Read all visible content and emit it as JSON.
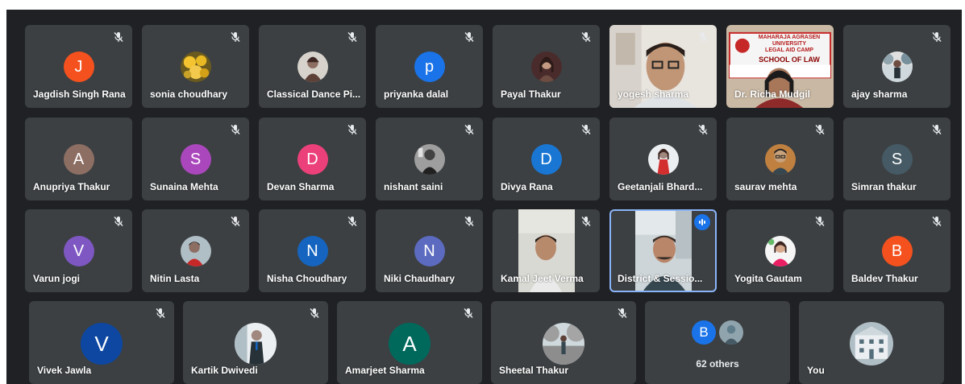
{
  "meeting": {
    "participants": [
      {
        "name": "Jagdish Singh Rana",
        "avatar": {
          "kind": "letter",
          "letter": "J",
          "color": "#f4511e"
        },
        "muted": true
      },
      {
        "name": "sonia choudhary",
        "avatar": {
          "kind": "photo",
          "photo": "yellow-flowers"
        },
        "muted": true
      },
      {
        "name": "Classical Dance Pi...",
        "avatar": {
          "kind": "photo",
          "photo": "dancer"
        },
        "muted": true
      },
      {
        "name": "priyanka dalal",
        "avatar": {
          "kind": "letter",
          "letter": "p",
          "color": "#1a73e8"
        },
        "muted": true
      },
      {
        "name": "Payal Thakur",
        "avatar": {
          "kind": "photo",
          "photo": "woman"
        },
        "muted": true
      },
      {
        "name": "yogesh sharma",
        "video": "man-with-glasses",
        "muted": true
      },
      {
        "name": "Dr. Richa Mudgil",
        "video": "woman-at-banner",
        "banner": [
          "MAHARAJA AGRASEN",
          "UNIVERSITY",
          "LEGAL AID CAMP",
          "SCHOOL OF LAW"
        ]
      },
      {
        "name": "ajay sharma",
        "avatar": {
          "kind": "photo",
          "photo": "person-trees"
        },
        "muted": true
      },
      {
        "name": "Anupriya Thakur",
        "avatar": {
          "kind": "letter",
          "letter": "A",
          "color": "#8d6e63"
        },
        "muted": false
      },
      {
        "name": "Sunaina Mehta",
        "avatar": {
          "kind": "letter",
          "letter": "S",
          "color": "#ab47bc"
        },
        "muted": true
      },
      {
        "name": "Devan Sharma",
        "avatar": {
          "kind": "letter",
          "letter": "D",
          "color": "#ec407a"
        },
        "muted": true
      },
      {
        "name": "nishant saini",
        "avatar": {
          "kind": "photo",
          "photo": "man-bw"
        },
        "muted": true
      },
      {
        "name": "Divya Rana",
        "avatar": {
          "kind": "letter",
          "letter": "D",
          "color": "#1976d2"
        },
        "muted": true
      },
      {
        "name": "Geetanjali Bhard...",
        "avatar": {
          "kind": "photo",
          "photo": "woman-red"
        },
        "muted": true
      },
      {
        "name": "saurav mehta",
        "avatar": {
          "kind": "photo",
          "photo": "man-glasses"
        },
        "muted": true
      },
      {
        "name": "Simran thakur",
        "avatar": {
          "kind": "letter",
          "letter": "S",
          "color": "#455a64"
        },
        "muted": true
      },
      {
        "name": "Varun jogi",
        "avatar": {
          "kind": "letter",
          "letter": "V",
          "color": "#7e57c2"
        },
        "muted": true
      },
      {
        "name": "Nitin Lasta",
        "avatar": {
          "kind": "photo",
          "photo": "man-red"
        },
        "muted": true
      },
      {
        "name": "Nisha Choudhary",
        "avatar": {
          "kind": "letter",
          "letter": "N",
          "color": "#1565c0"
        },
        "muted": true
      },
      {
        "name": "Niki Chaudhary",
        "avatar": {
          "kind": "letter",
          "letter": "N",
          "color": "#5c6bc0"
        },
        "muted": true
      },
      {
        "name": "Kamal Jeet Verma",
        "video": "man-in-room",
        "muted": true
      },
      {
        "name": "District & Sessio...",
        "video": "speaker-judge",
        "speaking": true
      },
      {
        "name": "Yogita Gautam",
        "avatar": {
          "kind": "photo",
          "photo": "woman-pink"
        },
        "muted": true
      },
      {
        "name": "Baldev Thakur",
        "avatar": {
          "kind": "letter",
          "letter": "B",
          "color": "#f4511e"
        },
        "muted": true
      },
      {
        "name": "Vivek Jawla",
        "avatar": {
          "kind": "letter",
          "letter": "V",
          "color": "#0d47a1"
        },
        "muted": true
      },
      {
        "name": "Kartik Dwivedi",
        "avatar": {
          "kind": "photo",
          "photo": "man-suit"
        },
        "muted": true
      },
      {
        "name": "Amarjeet Sharma",
        "avatar": {
          "kind": "letter",
          "letter": "A",
          "color": "#00695c"
        },
        "muted": true
      },
      {
        "name": "Sheetal Thakur",
        "avatar": {
          "kind": "photo",
          "photo": "woman-outdoor"
        },
        "muted": true
      }
    ],
    "others": {
      "label": "62 others",
      "letter": "B",
      "color": "#1a73e8"
    },
    "self": {
      "name": "You",
      "avatar": "building"
    }
  }
}
